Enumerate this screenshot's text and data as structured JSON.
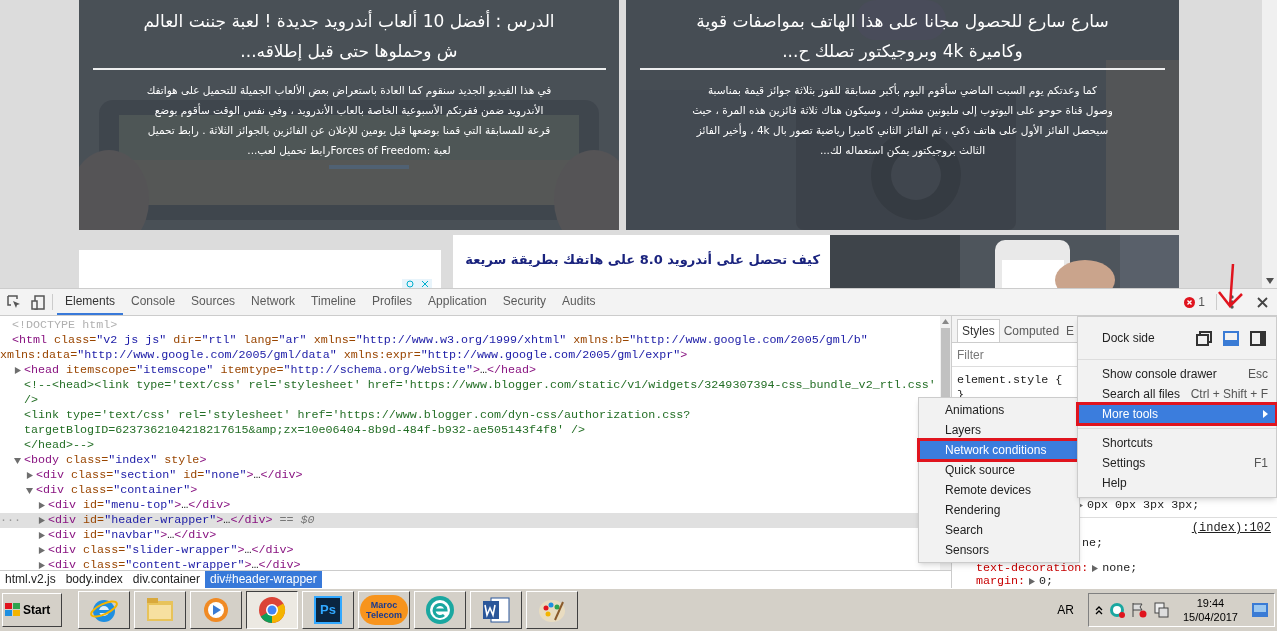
{
  "webpage": {
    "featured": [
      {
        "title_lines": [
          "سارع سارع للحصول مجانا على هذا الهاتف بمواصفات قوية",
          "وكاميرة 4k وبروجيكتور تصلك ح..."
        ],
        "excerpt_lines": [
          "كما وعدتكم يوم السبت الماضي سأقوم اليوم بأكبر مسابقة للفوز بثلاثة جوائز قيمة بمناسبة",
          "وصول قناة حوحو على اليوتوب إلى مليونين مشترك ، وسيكون هناك ثلاثة فائزين هذه المرة ، حيث",
          "سيحصل الفائز الأول على هاتف ذكي ، ثم الفائز الثاني كاميرا رياضية تصور بال 4k ، وأخير الفائز",
          "الثالث بروجيكتور يمكن استعماله لك..."
        ]
      },
      {
        "title_lines": [
          "الدرس : أفضل 10 ألعاب أندرويد جديدة ! لعبة جننت العالم",
          "ش وحملوها حتى قبل إطلاقه..."
        ],
        "excerpt_lines": [
          "في هذا الفيديو الجديد سنقوم كما العادة باستعراض بعض الألعاب الجميلة للتحميل على هواتفك",
          "الأندرويد ضمن فقرتكم الأسبوعية الخاصة بالعاب الأندرويد ، وفي نفس الوقت سأقوم بوضع",
          "قرعة للمسابقة التي قمنا بوضعها قبل يومين للإعلان عن الفائزين بالجوائز الثلاثة . رابط تحميل",
          "لعبة :Forces of Freedomرابط تحميل لعب..."
        ]
      }
    ],
    "post": {
      "title": "كيف تحصل على أندرويد 8.0 على هاتفك بطريقة سريعة"
    }
  },
  "devtools": {
    "tabs": [
      {
        "label": "Elements",
        "selected": true
      },
      {
        "label": "Console",
        "selected": false
      },
      {
        "label": "Sources",
        "selected": false
      },
      {
        "label": "Network",
        "selected": false
      },
      {
        "label": "Timeline",
        "selected": false
      },
      {
        "label": "Profiles",
        "selected": false
      },
      {
        "label": "Application",
        "selected": false
      },
      {
        "label": "Security",
        "selected": false
      },
      {
        "label": "Audits",
        "selected": false
      }
    ],
    "error_count": "1",
    "nodes": [
      {
        "selected": false,
        "lines": [
          [
            {
              "kind": "doctype",
              "text": "<!DOCTYPE html>"
            }
          ]
        ]
      },
      {
        "selected": false,
        "lines": [
          [
            {
              "kind": "tag",
              "text": "<html"
            },
            {
              "kind": "attr",
              "text": " class="
            },
            {
              "kind": "value",
              "text": "\"v2 js js\""
            },
            {
              "kind": "attr",
              "text": " dir="
            },
            {
              "kind": "value",
              "text": "\"rtl\""
            },
            {
              "kind": "attr",
              "text": " lang="
            },
            {
              "kind": "value",
              "text": "\"ar\""
            },
            {
              "kind": "attr",
              "text": " xmlns="
            },
            {
              "kind": "value",
              "text": "\"http://www.w3.org/1999/xhtml\""
            },
            {
              "kind": "attr",
              "text": " xmlns:b="
            },
            {
              "kind": "value",
              "text": "\"http://www.google.com/2005/gml/b\""
            }
          ],
          [
            {
              "kind": "attr",
              "text": "xmlns:data="
            },
            {
              "kind": "value",
              "text": "\"http://www.google.com/2005/gml/data\""
            },
            {
              "kind": "attr",
              "text": " xmlns:expr="
            },
            {
              "kind": "value",
              "text": "\"http://www.google.com/2005/gml/expr\""
            },
            {
              "kind": "tag",
              "text": ">"
            }
          ]
        ],
        "children": [
          {
            "kind": "collapsed",
            "selected": false,
            "lines": [
              [
                {
                  "kind": "tag",
                  "text": "<head"
                },
                {
                  "kind": "attr",
                  "text": " itemscope="
                },
                {
                  "kind": "value",
                  "text": "\"itemscope\""
                },
                {
                  "kind": "attr",
                  "text": " itemtype="
                },
                {
                  "kind": "value",
                  "text": "\"http://schema.org/WebSite\""
                },
                {
                  "kind": "tag",
                  "text": ">"
                },
                {
                  "kind": "plain",
                  "text": "…"
                },
                {
                  "kind": "tag",
                  "text": "</head>"
                }
              ]
            ]
          },
          {
            "selected": false,
            "lines": [
              [
                {
                  "kind": "comment",
                  "text": "<!--<head><link type='text/css' rel='stylesheet' href='https://www.blogger.com/static/v1/widgets/3249307394-css_bundle_v2_rtl.css'"
                }
              ],
              [
                {
                  "kind": "comment",
                  "text": "/>"
                }
              ],
              [
                {
                  "kind": "comment",
                  "text": "<link type='text/css' rel='stylesheet' href='https://www.blogger.com/dyn-css/authorization.css?"
                }
              ],
              [
                {
                  "kind": "comment",
                  "text": "targetBlogID=6237362104218217615&amp;zx=10e06404-8b9d-484f-b932-ae505143f4f8' />"
                }
              ],
              [
                {
                  "kind": "comment",
                  "text": "</head>-->"
                }
              ]
            ]
          },
          {
            "kind": "expanded",
            "selected": false,
            "lines": [
              [
                {
                  "kind": "tag",
                  "text": "<body"
                },
                {
                  "kind": "attr",
                  "text": " class="
                },
                {
                  "kind": "value",
                  "text": "\"index\""
                },
                {
                  "kind": "attr",
                  "text": " style"
                },
                {
                  "kind": "tag",
                  "text": ">"
                }
              ]
            ],
            "children": [
              {
                "kind": "collapsed",
                "selected": false,
                "lines": [
                  [
                    {
                      "kind": "tag",
                      "text": "<div"
                    },
                    {
                      "kind": "attr",
                      "text": " class="
                    },
                    {
                      "kind": "value",
                      "text": "\"section\""
                    },
                    {
                      "kind": "attr",
                      "text": " id="
                    },
                    {
                      "kind": "value",
                      "text": "\"none\""
                    },
                    {
                      "kind": "tag",
                      "text": ">"
                    },
                    {
                      "kind": "plain",
                      "text": "…"
                    },
                    {
                      "kind": "tag",
                      "text": "</div>"
                    }
                  ]
                ]
              },
              {
                "kind": "expanded",
                "selected": false,
                "lines": [
                  [
                    {
                      "kind": "tag",
                      "text": "<div"
                    },
                    {
                      "kind": "attr",
                      "text": " class="
                    },
                    {
                      "kind": "value",
                      "text": "\"container\""
                    },
                    {
                      "kind": "tag",
                      "text": ">"
                    }
                  ]
                ],
                "children": [
                  {
                    "kind": "collapsed",
                    "selected": false,
                    "lines": [
                      [
                        {
                          "kind": "tag",
                          "text": "<div"
                        },
                        {
                          "kind": "attr",
                          "text": " id="
                        },
                        {
                          "kind": "value",
                          "text": "\"menu-top\""
                        },
                        {
                          "kind": "tag",
                          "text": ">"
                        },
                        {
                          "kind": "plain",
                          "text": "…"
                        },
                        {
                          "kind": "tag",
                          "text": "</div>"
                        }
                      ]
                    ]
                  },
                  {
                    "kind": "collapsed",
                    "selected": true,
                    "gutter": "···",
                    "lines": [
                      [
                        {
                          "kind": "tag",
                          "text": "<div"
                        },
                        {
                          "kind": "attr",
                          "text": " id="
                        },
                        {
                          "kind": "value",
                          "text": "\"header-wrapper\""
                        },
                        {
                          "kind": "tag",
                          "text": ">"
                        },
                        {
                          "kind": "plain",
                          "text": "…"
                        },
                        {
                          "kind": "tag",
                          "text": "</div>"
                        },
                        {
                          "kind": "marker",
                          "text": " == $0"
                        }
                      ]
                    ]
                  },
                  {
                    "kind": "collapsed",
                    "selected": false,
                    "lines": [
                      [
                        {
                          "kind": "tag",
                          "text": "<div"
                        },
                        {
                          "kind": "attr",
                          "text": " id="
                        },
                        {
                          "kind": "value",
                          "text": "\"navbar\""
                        },
                        {
                          "kind": "tag",
                          "text": ">"
                        },
                        {
                          "kind": "plain",
                          "text": "…"
                        },
                        {
                          "kind": "tag",
                          "text": "</div>"
                        }
                      ]
                    ]
                  },
                  {
                    "kind": "collapsed",
                    "selected": false,
                    "lines": [
                      [
                        {
                          "kind": "tag",
                          "text": "<div"
                        },
                        {
                          "kind": "attr",
                          "text": " class="
                        },
                        {
                          "kind": "value",
                          "text": "\"slider-wrapper\""
                        },
                        {
                          "kind": "tag",
                          "text": ">"
                        },
                        {
                          "kind": "plain",
                          "text": "…"
                        },
                        {
                          "kind": "tag",
                          "text": "</div>"
                        }
                      ]
                    ]
                  },
                  {
                    "kind": "collapsed",
                    "selected": false,
                    "lines": [
                      [
                        {
                          "kind": "tag",
                          "text": "<div"
                        },
                        {
                          "kind": "attr",
                          "text": " class="
                        },
                        {
                          "kind": "value",
                          "text": "\"content-wrapper\""
                        },
                        {
                          "kind": "tag",
                          "text": ">"
                        },
                        {
                          "kind": "plain",
                          "text": "…"
                        },
                        {
                          "kind": "tag",
                          "text": "</div>"
                        }
                      ]
                    ]
                  }
                ]
              }
            ]
          }
        ]
      }
    ],
    "breadcrumbs": [
      {
        "label": "html.v2.js",
        "selected": false
      },
      {
        "label": "body.index",
        "selected": false
      },
      {
        "label": "div.container",
        "selected": false
      },
      {
        "label": "div#header-wrapper",
        "selected": true
      }
    ],
    "styles": {
      "tabs": [
        {
          "label": "Styles",
          "selected": true
        },
        {
          "label": "Computed",
          "selected": false
        },
        {
          "label": "E",
          "selected": false
        }
      ],
      "filter_placeholder": "Filter",
      "element_style_open": "element.style {",
      "element_style_close": "}",
      "shadow_value": "0px 0px 3px 3px;",
      "source_link": "(index):102",
      "partial_value": "ne;",
      "declarations": [
        {
          "property": "text-decoration:",
          "value": "none;"
        },
        {
          "property": "margin:",
          "value": "0;"
        }
      ]
    },
    "menu": {
      "dock_label": "Dock side",
      "dock_options": [
        {
          "kind": "undock",
          "selected": false
        },
        {
          "kind": "bottom",
          "selected": true
        },
        {
          "kind": "right",
          "selected": false
        }
      ],
      "items": [
        {
          "label": "Show console drawer",
          "shortcut": "Esc",
          "selected": false,
          "outlined": false,
          "submenu": false
        },
        {
          "label": "Search all files",
          "shortcut": "Ctrl + Shift + F",
          "selected": false,
          "outlined": false,
          "submenu": false
        },
        {
          "label": "More tools",
          "selected": true,
          "outlined": true,
          "submenu": true
        },
        {
          "label": "Shortcuts",
          "selected": false,
          "outlined": false,
          "submenu": false
        },
        {
          "label": "Settings",
          "shortcut": "F1",
          "selected": false,
          "outlined": false,
          "submenu": false
        },
        {
          "label": "Help",
          "selected": false,
          "outlined": false,
          "submenu": false
        }
      ]
    },
    "submenu": [
      {
        "label": "Animations",
        "selected": false,
        "outlined": false
      },
      {
        "label": "Layers",
        "selected": false,
        "outlined": false
      },
      {
        "label": "Network conditions",
        "selected": true,
        "outlined": true
      },
      {
        "label": "Quick source",
        "selected": false,
        "outlined": false
      },
      {
        "label": "Remote devices",
        "selected": false,
        "outlined": false
      },
      {
        "label": "Rendering",
        "selected": false,
        "outlined": false
      },
      {
        "label": "Search",
        "selected": false,
        "outlined": false
      },
      {
        "label": "Sensors",
        "selected": false,
        "outlined": false
      }
    ]
  },
  "taskbar": {
    "start": "Start",
    "apps": [
      {
        "kind": "ie",
        "selected": false
      },
      {
        "kind": "folder",
        "selected": false
      },
      {
        "kind": "media",
        "selected": false
      },
      {
        "kind": "chrome",
        "selected": true
      },
      {
        "kind": "photoshop",
        "label": "Ps",
        "selected": false
      },
      {
        "kind": "telecom",
        "label": "Maroc Telecom",
        "selected": false
      },
      {
        "kind": "eset",
        "selected": false
      },
      {
        "kind": "word",
        "selected": false
      },
      {
        "kind": "paint",
        "selected": false
      }
    ],
    "language": "AR",
    "time": "19:44",
    "date": "15/04/2017"
  }
}
